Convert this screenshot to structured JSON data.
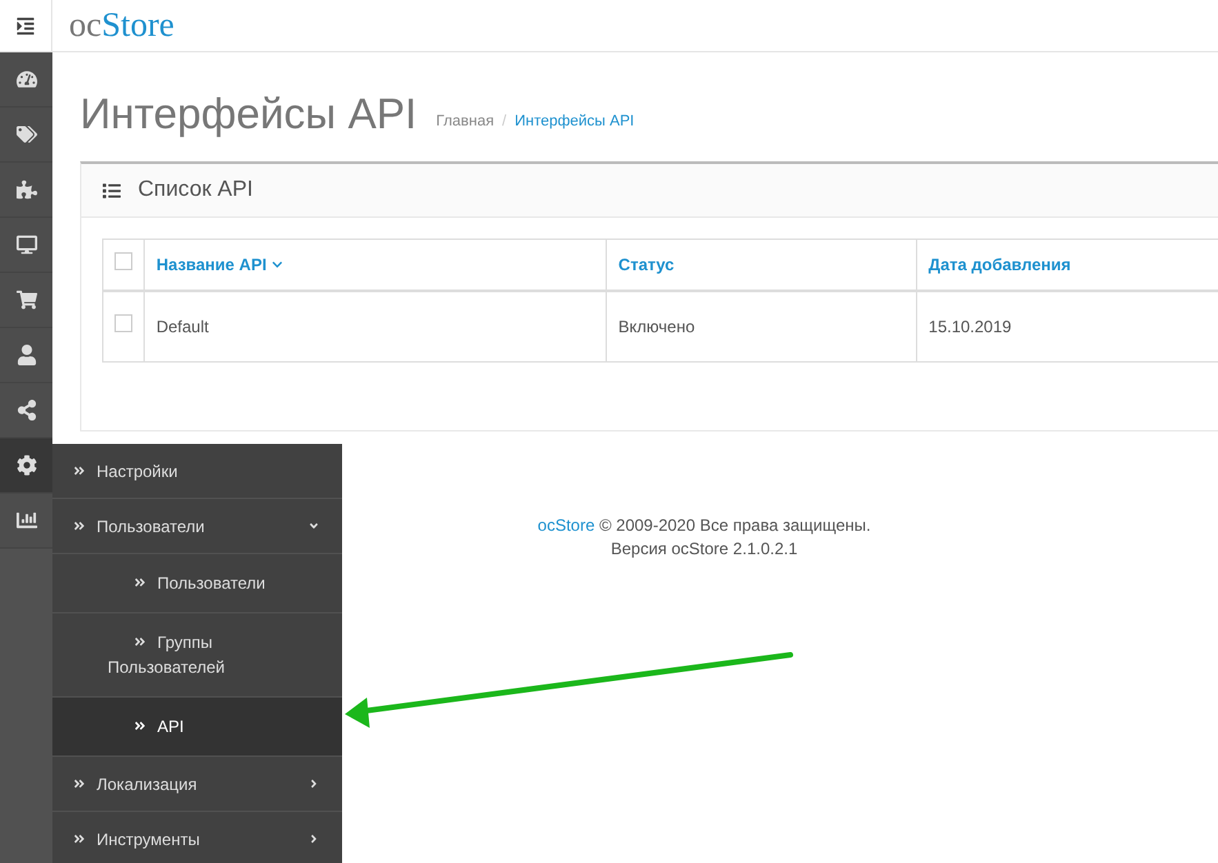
{
  "header": {
    "logo_prefix": "oc",
    "logo_name": "Store"
  },
  "sidebar_icons": [
    {
      "selected": false
    },
    {
      "selected": false
    },
    {
      "selected": false
    },
    {
      "selected": false
    },
    {
      "selected": false
    },
    {
      "selected": false
    },
    {
      "selected": false
    },
    {
      "selected": true
    },
    {
      "selected": false
    }
  ],
  "menu": [
    {
      "label": "Настройки",
      "kind": "link",
      "selected": false
    },
    {
      "label": "Пользователи",
      "kind": "folder",
      "expanded": true,
      "selected": false,
      "children": [
        {
          "label": "Пользователи",
          "selected": false
        },
        {
          "label": "Группы Пользователей",
          "selected": false
        },
        {
          "label": "API",
          "selected": true
        }
      ]
    },
    {
      "label": "Локализация",
      "kind": "folder",
      "expanded": false,
      "selected": false
    },
    {
      "label": "Инструменты",
      "kind": "folder",
      "expanded": false,
      "selected": false
    }
  ],
  "page": {
    "title": "Интерфейсы API",
    "breadcrumb_separator": "/",
    "breadcrumbs": [
      {
        "label": "Главная",
        "current": false
      },
      {
        "label": "Интерфейсы API",
        "current": true
      }
    ]
  },
  "panel": {
    "title": "Список API",
    "table": {
      "columns": [
        {
          "label": "Название API",
          "sorted": true
        },
        {
          "label": "Статус",
          "sorted": false
        },
        {
          "label": "Дата добавления",
          "sorted": false
        }
      ],
      "header_checked": false,
      "rows": [
        {
          "checked": false,
          "cells": [
            "Default",
            "Включено",
            "15.10.2019"
          ]
        }
      ]
    }
  },
  "footer": {
    "link": "ocStore",
    "text": "© 2009-2020 Все права защищены.",
    "version": "Версия ocStore 2.1.0.2.1"
  }
}
